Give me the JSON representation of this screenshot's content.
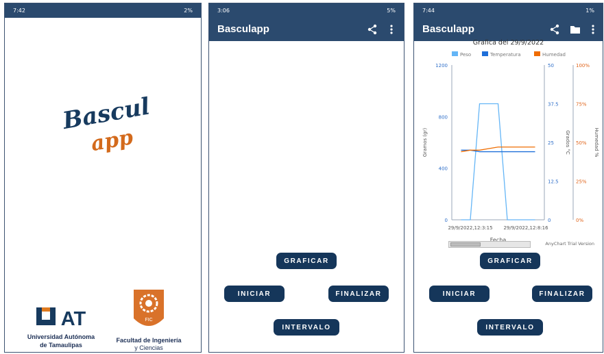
{
  "screen1": {
    "status": {
      "time": "7:42",
      "battery": "2%"
    },
    "logo_line1": "Bascul",
    "logo_line2": "app",
    "uat_logo": "UAT",
    "uat_name_line1": "Universidad Autónoma",
    "uat_name_line2": "de Tamaulipas",
    "fic_badge": "FIC",
    "fic_name": "Facultad de Ingeniería",
    "fic_sub": "y Ciencias"
  },
  "screen2": {
    "status": {
      "time": "3:06",
      "battery": "5%"
    },
    "title": "Basculapp",
    "buttons": {
      "graficar": "GRAFICAR",
      "iniciar": "INICIAR",
      "finalizar": "FINALIZAR",
      "intervalo": "INTERVALO"
    }
  },
  "screen3": {
    "status": {
      "time": "7:44",
      "battery": "1%"
    },
    "title": "Basculapp",
    "trial_label": "AnyChart Trial Version",
    "buttons": {
      "graficar": "GRAFICAR",
      "iniciar": "INICIAR",
      "finalizar": "FINALIZAR",
      "intervalo": "INTERVALO"
    }
  },
  "icons": {
    "share": "share-icon",
    "menu": "more-vert-icon",
    "folder": "folder-icon"
  },
  "colors": {
    "appbar": "#2b4a6e",
    "button": "#15365a",
    "peso": "#64b5f6",
    "temperatura": "#1e6fd9",
    "humedad": "#ef6c00"
  },
  "chart_data": {
    "type": "line",
    "title": "Grafica del 29/9/2022",
    "xlabel": "Fecha",
    "x_tick_labels": [
      "29/9/2022,12:3:15",
      "29/9/2022,12:8:16"
    ],
    "x_tick_positions": [
      2,
      8
    ],
    "x_range": [
      0,
      10
    ],
    "axes": [
      {
        "id": "gramos",
        "label": "Gramos (gr)",
        "ticks": [
          "0",
          "400",
          "800",
          "1200"
        ],
        "ylim": [
          0,
          1200
        ],
        "side": "left"
      },
      {
        "id": "grados",
        "label": "Grados °C",
        "ticks": [
          "0",
          "12.5",
          "25",
          "37.5",
          "50"
        ],
        "ylim": [
          0,
          50
        ],
        "side": "right"
      },
      {
        "id": "humedad",
        "label": "Humedad %",
        "ticks": [
          "0%",
          "25%",
          "50%",
          "75%",
          "100%"
        ],
        "ylim": [
          0,
          100
        ],
        "side": "right"
      }
    ],
    "legend": [
      "Peso",
      "Temperatura",
      "Humedad"
    ],
    "legend_position": "top",
    "series": [
      {
        "name": "Peso",
        "axis": "gramos",
        "x": [
          1,
          2,
          3,
          4,
          5,
          6,
          7,
          8,
          9
        ],
        "values": [
          0,
          0,
          900,
          900,
          900,
          0,
          0,
          0,
          0
        ]
      },
      {
        "name": "Temperatura",
        "axis": "grados",
        "x": [
          1,
          2,
          3,
          4,
          5,
          6,
          7,
          8,
          9
        ],
        "values": [
          22.5,
          22.5,
          22,
          22,
          22,
          22,
          22,
          22,
          22
        ]
      },
      {
        "name": "Humedad",
        "axis": "humedad",
        "x": [
          1,
          2,
          3,
          4,
          5,
          6,
          7,
          8,
          9
        ],
        "values": [
          44,
          45,
          45,
          46,
          47,
          47,
          47,
          47,
          47
        ]
      }
    ]
  }
}
